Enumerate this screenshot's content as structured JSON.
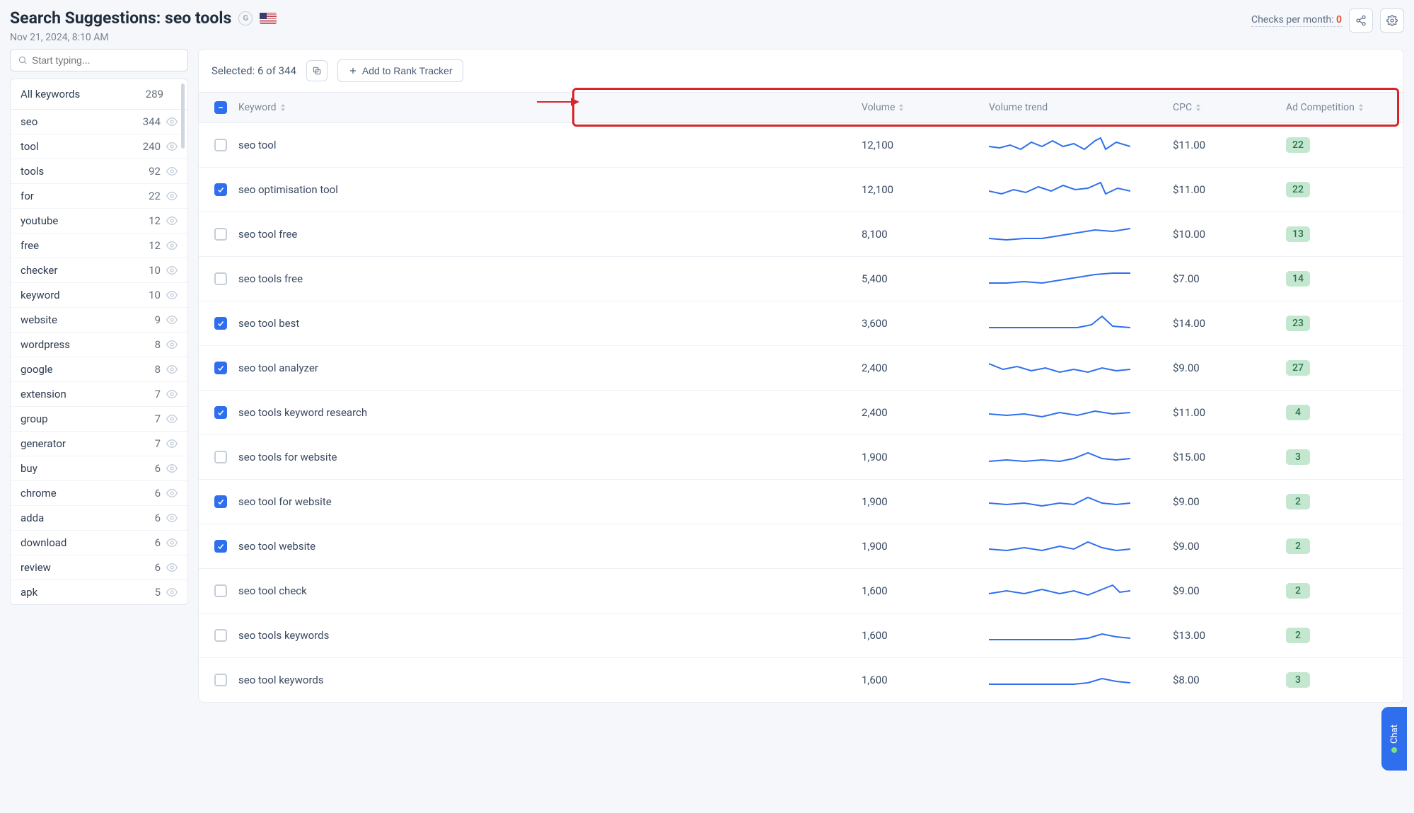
{
  "header": {
    "title_prefix": "Search Suggestions:",
    "title_term": "seo tools",
    "timestamp": "Nov 21, 2024, 8:10 AM",
    "checks_label": "Checks per month:",
    "checks_value": "0"
  },
  "search": {
    "placeholder": "Start typing..."
  },
  "sidebar": {
    "header_label": "All keywords",
    "header_count": "289",
    "items": [
      {
        "label": "seo",
        "count": "344"
      },
      {
        "label": "tool",
        "count": "240"
      },
      {
        "label": "tools",
        "count": "92"
      },
      {
        "label": "for",
        "count": "22"
      },
      {
        "label": "youtube",
        "count": "12"
      },
      {
        "label": "free",
        "count": "12"
      },
      {
        "label": "checker",
        "count": "10"
      },
      {
        "label": "keyword",
        "count": "10"
      },
      {
        "label": "website",
        "count": "9"
      },
      {
        "label": "wordpress",
        "count": "8"
      },
      {
        "label": "google",
        "count": "8"
      },
      {
        "label": "extension",
        "count": "7"
      },
      {
        "label": "group",
        "count": "7"
      },
      {
        "label": "generator",
        "count": "7"
      },
      {
        "label": "buy",
        "count": "6"
      },
      {
        "label": "chrome",
        "count": "6"
      },
      {
        "label": "adda",
        "count": "6"
      },
      {
        "label": "download",
        "count": "6"
      },
      {
        "label": "review",
        "count": "6"
      },
      {
        "label": "apk",
        "count": "5"
      }
    ]
  },
  "toolbar": {
    "selected_label": "Selected: 6 of 344",
    "add_button": "Add to Rank Tracker"
  },
  "columns": {
    "keyword": "Keyword",
    "volume": "Volume",
    "trend": "Volume trend",
    "cpc": "CPC",
    "adc": "Ad Competition"
  },
  "rows": [
    {
      "checked": false,
      "keyword": "seo tool",
      "volume": "12,100",
      "cpc": "$11.00",
      "adc": "22",
      "spark": "0,18 15,20 30,16 45,22 60,12 75,18 90,10 105,18 120,14 135,22 150,10 158,6 165,22 180,12 200,18"
    },
    {
      "checked": true,
      "keyword": "seo optimisation tool",
      "volume": "12,100",
      "cpc": "$11.00",
      "adc": "22",
      "spark": "0,18 18,22 35,16 52,20 70,12 88,18 105,10 122,16 140,14 158,6 165,22 182,14 200,18"
    },
    {
      "checked": false,
      "keyword": "seo tool free",
      "volume": "8,100",
      "cpc": "$10.00",
      "adc": "13",
      "spark": "0,22 25,24 50,22 75,22 100,18 125,14 150,10 175,12 200,8"
    },
    {
      "checked": false,
      "keyword": "seo tools free",
      "volume": "5,400",
      "cpc": "$7.00",
      "adc": "14",
      "spark": "0,22 25,22 50,20 75,22 100,18 125,14 150,10 175,8 200,8"
    },
    {
      "checked": true,
      "keyword": "seo tool best",
      "volume": "3,600",
      "cpc": "$14.00",
      "adc": "23",
      "spark": "0,22 25,22 50,22 75,22 100,22 125,22 145,18 160,6 175,20 200,22"
    },
    {
      "checked": true,
      "keyword": "seo tool analyzer",
      "volume": "2,400",
      "cpc": "$9.00",
      "adc": "27",
      "spark": "0,10 20,18 40,14 60,20 80,16 100,22 120,18 140,22 160,16 180,20 200,18"
    },
    {
      "checked": true,
      "keyword": "seo tools keyword research",
      "volume": "2,400",
      "cpc": "$11.00",
      "adc": "4",
      "spark": "0,18 25,20 50,18 75,22 100,16 125,20 150,14 175,18 200,16"
    },
    {
      "checked": false,
      "keyword": "seo tools for website",
      "volume": "1,900",
      "cpc": "$15.00",
      "adc": "3",
      "spark": "0,22 25,20 50,22 75,20 100,22 120,18 140,10 160,18 180,20 200,18"
    },
    {
      "checked": true,
      "keyword": "seo tool for website",
      "volume": "1,900",
      "cpc": "$9.00",
      "adc": "2",
      "spark": "0,18 25,20 50,18 75,22 100,18 120,20 140,10 160,18 180,20 200,18"
    },
    {
      "checked": true,
      "keyword": "seo tool website",
      "volume": "1,900",
      "cpc": "$9.00",
      "adc": "2",
      "spark": "0,20 25,22 50,18 75,22 100,16 120,20 140,10 160,18 180,22 200,20"
    },
    {
      "checked": false,
      "keyword": "seo tool check",
      "volume": "1,600",
      "cpc": "$9.00",
      "adc": "2",
      "spark": "0,20 25,16 50,20 75,14 100,20 120,16 140,22 160,14 175,8 185,18 200,16"
    },
    {
      "checked": false,
      "keyword": "seo tools keywords",
      "volume": "1,600",
      "cpc": "$13.00",
      "adc": "2",
      "spark": "0,22 30,22 60,22 90,22 120,22 140,20 160,14 180,18 200,20"
    },
    {
      "checked": false,
      "keyword": "seo tool keywords",
      "volume": "1,600",
      "cpc": "$8.00",
      "adc": "3",
      "spark": "0,22 30,22 60,22 90,22 120,22 140,20 160,14 180,18 200,20"
    }
  ],
  "chat": {
    "label": "Chat"
  }
}
